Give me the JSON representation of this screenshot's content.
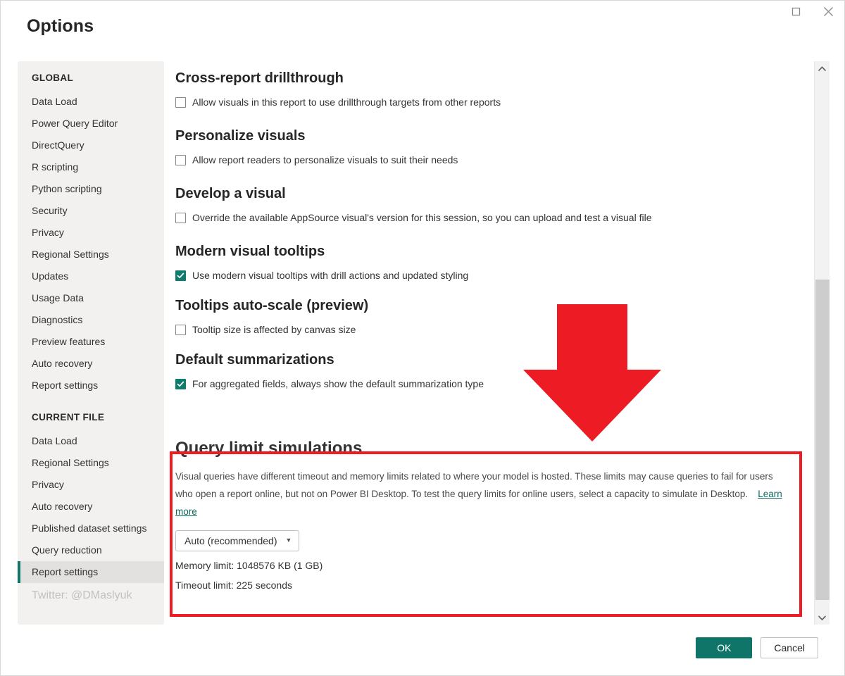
{
  "window": {
    "title": "Options",
    "maximize_icon": "maximize-icon",
    "close_icon": "close-icon"
  },
  "sidebar": {
    "groups": [
      {
        "title": "GLOBAL",
        "items": [
          {
            "label": "Data Load",
            "selected": false
          },
          {
            "label": "Power Query Editor",
            "selected": false
          },
          {
            "label": "DirectQuery",
            "selected": false
          },
          {
            "label": "R scripting",
            "selected": false
          },
          {
            "label": "Python scripting",
            "selected": false
          },
          {
            "label": "Security",
            "selected": false
          },
          {
            "label": "Privacy",
            "selected": false
          },
          {
            "label": "Regional Settings",
            "selected": false
          },
          {
            "label": "Updates",
            "selected": false
          },
          {
            "label": "Usage Data",
            "selected": false
          },
          {
            "label": "Diagnostics",
            "selected": false
          },
          {
            "label": "Preview features",
            "selected": false
          },
          {
            "label": "Auto recovery",
            "selected": false
          },
          {
            "label": "Report settings",
            "selected": false
          }
        ]
      },
      {
        "title": "CURRENT FILE",
        "items": [
          {
            "label": "Data Load",
            "selected": false
          },
          {
            "label": "Regional Settings",
            "selected": false
          },
          {
            "label": "Privacy",
            "selected": false
          },
          {
            "label": "Auto recovery",
            "selected": false
          },
          {
            "label": "Published dataset settings",
            "selected": false
          },
          {
            "label": "Query reduction",
            "selected": false
          },
          {
            "label": "Report settings",
            "selected": true
          }
        ]
      }
    ],
    "watermark": "Twitter: @DMaslyuk"
  },
  "main": {
    "sections": [
      {
        "heading": "Cross-report drillthrough",
        "checkbox_label": "Allow visuals in this report to use drillthrough targets from other reports",
        "checked": false
      },
      {
        "heading": "Personalize visuals",
        "checkbox_label": "Allow report readers to personalize visuals to suit their needs",
        "checked": false
      },
      {
        "heading": "Develop a visual",
        "checkbox_label": "Override the available AppSource visual's version for this session, so you can upload and test a visual file",
        "checked": false
      },
      {
        "heading": "Modern visual tooltips",
        "checkbox_label": "Use modern visual tooltips with drill actions and updated styling",
        "checked": true
      },
      {
        "heading": "Tooltips auto-scale (preview)",
        "checkbox_label": "Tooltip size is affected by canvas size",
        "checked": false
      },
      {
        "heading": "Default summarizations",
        "checkbox_label": "For aggregated fields, always show the default summarization type",
        "checked": true
      }
    ],
    "query_limit": {
      "heading": "Query limit simulations",
      "description": "Visual queries have different timeout and memory limits related to where your model is hosted. These limits may cause queries to fail for users who open a report online, but not on Power BI Desktop. To test the query limits for online users, select a capacity to simulate in Desktop.",
      "learn_more": "Learn more",
      "capacity_value": "Auto (recommended)",
      "memory_limit": "Memory limit: 1048576 KB (1 GB)",
      "timeout_limit": "Timeout limit: 225 seconds"
    }
  },
  "annotations": {
    "arrow_color": "#ed1c24",
    "highlight_color": "#ef1c24"
  },
  "scrollbar": {
    "up_icon": "chevron-up-icon",
    "down_icon": "chevron-down-icon"
  },
  "footer": {
    "ok_label": "OK",
    "cancel_label": "Cancel"
  },
  "colors": {
    "accent_teal": "#107569",
    "selected_bar": "#0f766a",
    "link": "#0f6b62"
  }
}
